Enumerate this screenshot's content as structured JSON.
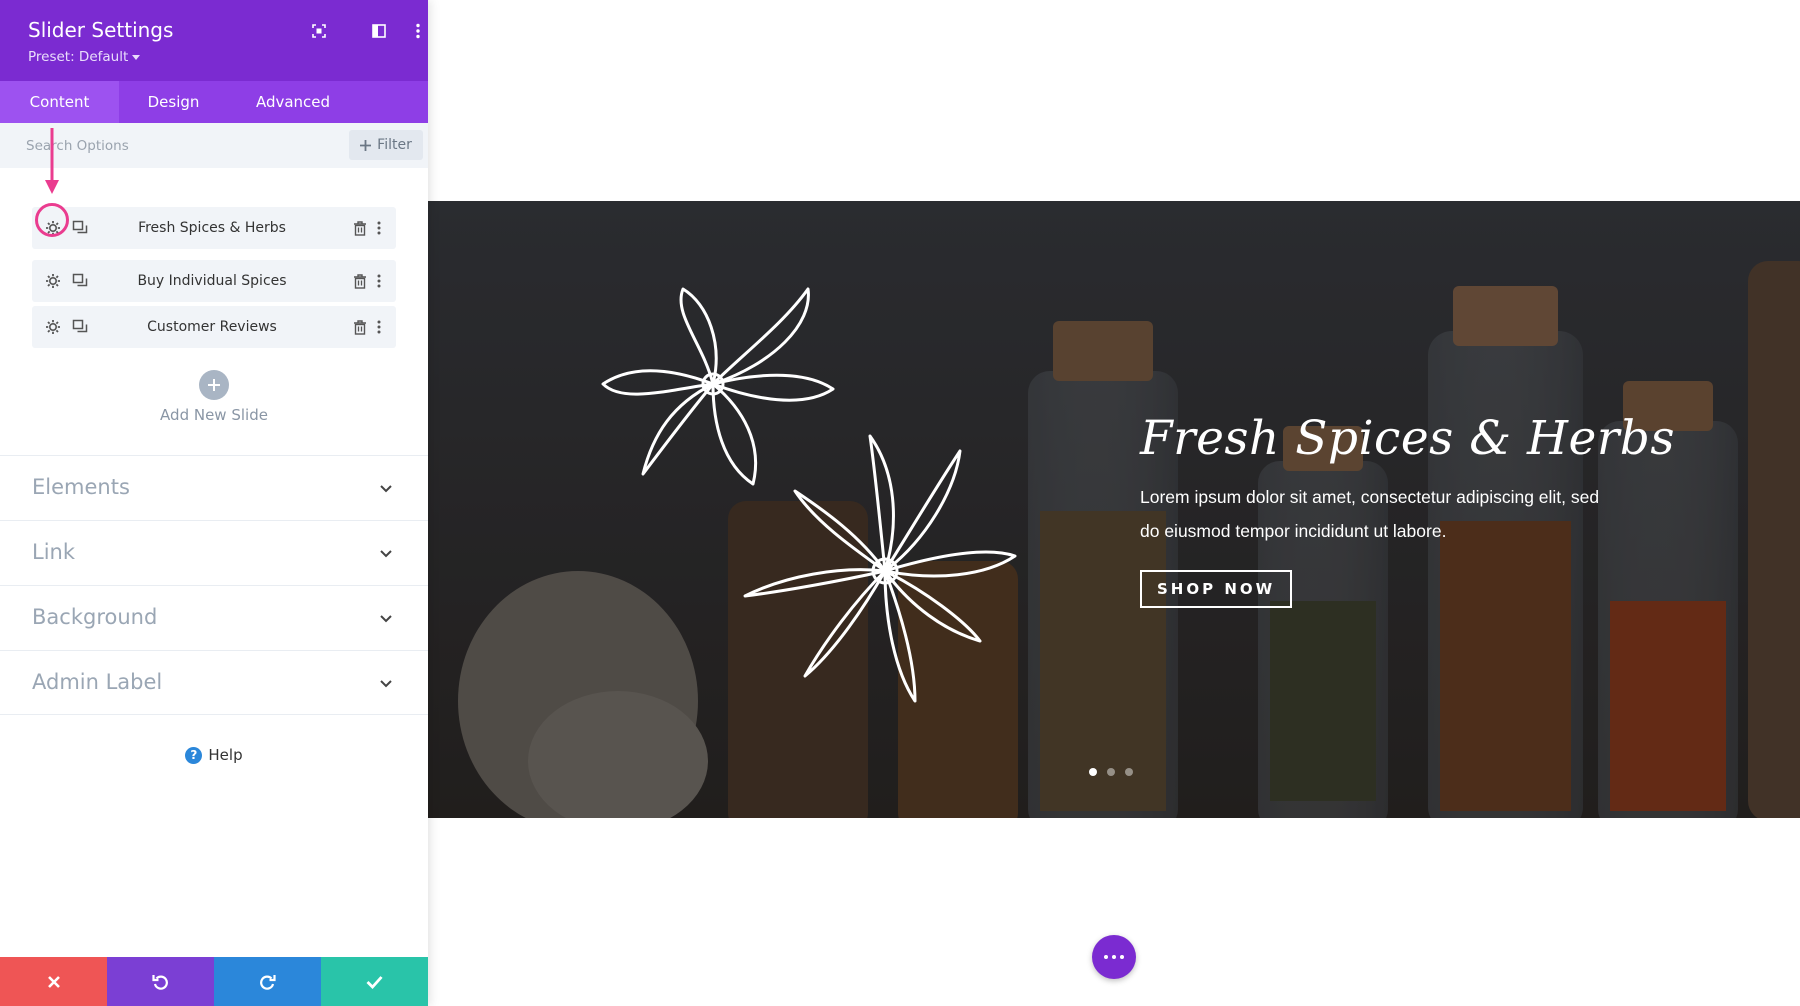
{
  "panel": {
    "title": "Slider Settings",
    "preset": "Preset: Default",
    "tabs": [
      {
        "label": "Content",
        "active": true
      },
      {
        "label": "Design",
        "active": false
      },
      {
        "label": "Advanced",
        "active": false
      }
    ],
    "search": {
      "placeholder": "Search Options",
      "value": ""
    },
    "filter_label": "Filter",
    "slides": [
      {
        "label": "Fresh Spices & Herbs"
      },
      {
        "label": "Buy Individual Spices"
      },
      {
        "label": "Customer Reviews"
      }
    ],
    "add_slide_label": "Add New Slide",
    "sections": [
      {
        "label": "Elements"
      },
      {
        "label": "Link"
      },
      {
        "label": "Background"
      },
      {
        "label": "Admin Label"
      }
    ],
    "help_label": "Help",
    "footer": {
      "discard_icon": "close-icon",
      "undo_icon": "undo-icon",
      "redo_icon": "redo-icon",
      "save_icon": "check-icon",
      "colors": [
        "#ef5555",
        "#7b3fd4",
        "#2b87da",
        "#29c4a9"
      ]
    },
    "accent": "#7b2bd1",
    "highlight_color": "#ea3c8f"
  },
  "slider": {
    "title": "Fresh Spices & Herbs",
    "body": "Lorem ipsum dolor sit amet, consectetur adipiscing elit, sed do eiusmod tempor incididunt ut labore.",
    "button_label": "SHOP NOW",
    "dots_count": 3,
    "active_dot": 0
  },
  "fab_icon": "more-horizontal-icon"
}
